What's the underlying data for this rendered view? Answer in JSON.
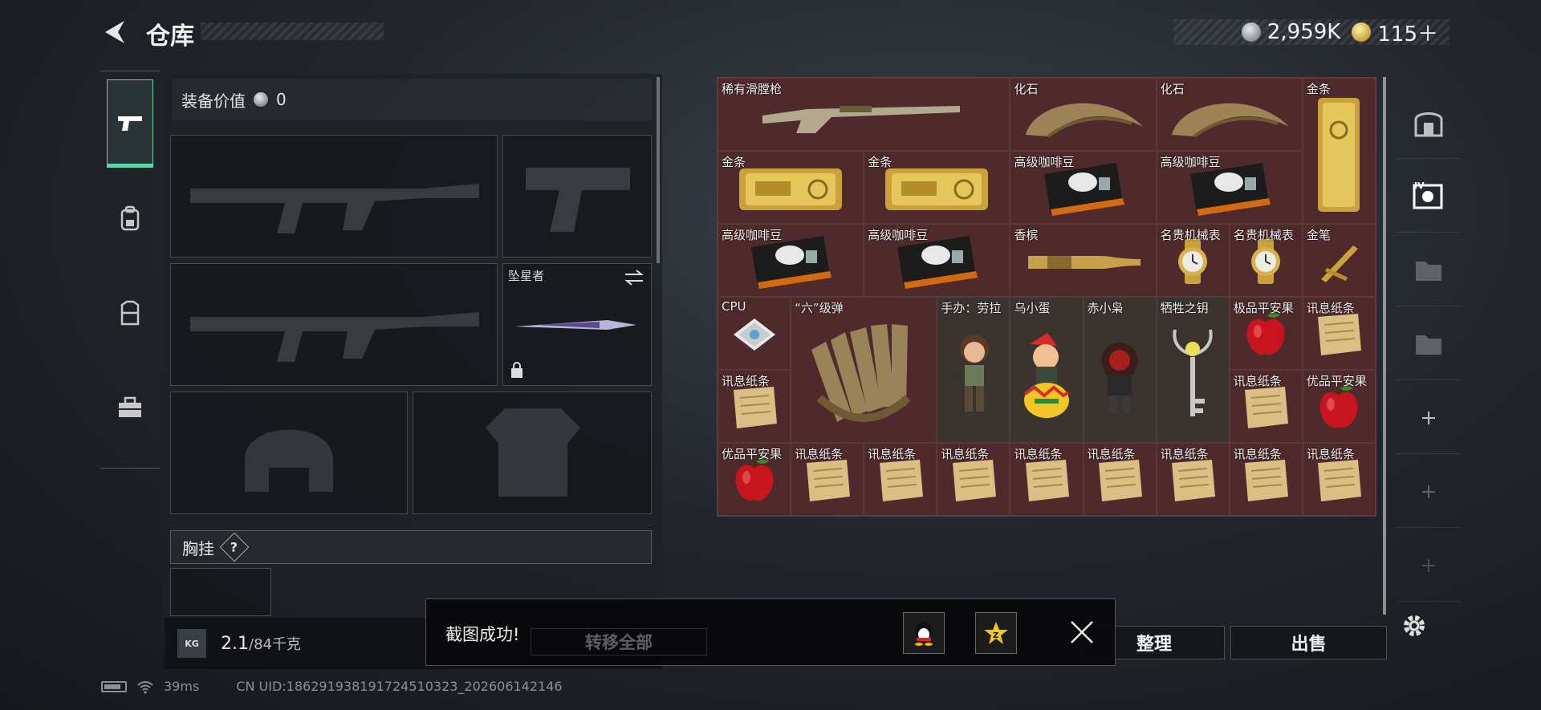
{
  "header": {
    "title": "仓库",
    "currency": [
      {
        "icon": "silver-coin-icon",
        "value": "2,959K"
      },
      {
        "icon": "gold-coin-icon",
        "value": "115＋"
      }
    ]
  },
  "left_tabs": [
    {
      "icon": "pistol-icon",
      "active": true
    },
    {
      "icon": "backpack-icon",
      "active": false
    },
    {
      "icon": "vest-icon",
      "active": false
    },
    {
      "icon": "toolbox-icon",
      "active": false
    }
  ],
  "equipment": {
    "value_label": "装备价值",
    "value_amount": "0",
    "melee_slot_label": "坠星者",
    "chest_label": "胸挂",
    "chest_help": "?",
    "weight_current": "2.1",
    "weight_max": "/84千克",
    "kg_badge": "KG"
  },
  "stash": {
    "items": [
      {
        "label": "稀有滑膛枪",
        "icon": "musket-icon",
        "col": 1,
        "row": 1,
        "w": 4,
        "h": 1
      },
      {
        "label": "化石",
        "icon": "fossil-claw-icon",
        "col": 5,
        "row": 1,
        "w": 2,
        "h": 1
      },
      {
        "label": "化石",
        "icon": "fossil-claw-icon",
        "col": 7,
        "row": 1,
        "w": 2,
        "h": 1
      },
      {
        "label": "金条",
        "icon": "gold-bar-icon",
        "col": 9,
        "row": 1,
        "w": 1,
        "h": 2
      },
      {
        "label": "金条",
        "icon": "gold-bar-icon",
        "col": 1,
        "row": 2,
        "w": 2,
        "h": 1
      },
      {
        "label": "金条",
        "icon": "gold-bar-icon",
        "col": 3,
        "row": 2,
        "w": 2,
        "h": 1
      },
      {
        "label": "高级咖啡豆",
        "icon": "coffee-beans-icon",
        "col": 5,
        "row": 2,
        "w": 2,
        "h": 1
      },
      {
        "label": "高级咖啡豆",
        "icon": "coffee-beans-icon",
        "col": 7,
        "row": 2,
        "w": 2,
        "h": 1
      },
      {
        "label": "高级咖啡豆",
        "icon": "coffee-beans-icon",
        "col": 1,
        "row": 3,
        "w": 2,
        "h": 1
      },
      {
        "label": "高级咖啡豆",
        "icon": "coffee-beans-icon",
        "col": 3,
        "row": 3,
        "w": 2,
        "h": 1
      },
      {
        "label": "香槟",
        "icon": "champagne-icon",
        "col": 5,
        "row": 3,
        "w": 2,
        "h": 1
      },
      {
        "label": "名贵机械表",
        "icon": "watch-icon",
        "col": 7,
        "row": 3,
        "w": 1,
        "h": 1
      },
      {
        "label": "名贵机械表",
        "icon": "watch-icon",
        "col": 8,
        "row": 3,
        "w": 1,
        "h": 1
      },
      {
        "label": "金笔",
        "icon": "gold-pen-icon",
        "col": 9,
        "row": 3,
        "w": 1,
        "h": 1
      },
      {
        "label": "CPU",
        "icon": "cpu-icon",
        "col": 1,
        "row": 4,
        "w": 1,
        "h": 1
      },
      {
        "label": "“六”级弹",
        "icon": "bullets-icon",
        "col": 2,
        "row": 4,
        "w": 2,
        "h": 2
      },
      {
        "label": "手办：劳拉",
        "icon": "figure-lara-icon",
        "col": 4,
        "row": 4,
        "w": 1,
        "h": 2
      },
      {
        "label": "乌小蛋",
        "icon": "figure-egg-icon",
        "col": 5,
        "row": 4,
        "w": 1,
        "h": 2
      },
      {
        "label": "赤小枭",
        "icon": "figure-hood-icon",
        "col": 6,
        "row": 4,
        "w": 1,
        "h": 2
      },
      {
        "label": "牺牲之钥",
        "icon": "key-icon",
        "col": 7,
        "row": 4,
        "w": 1,
        "h": 2
      },
      {
        "label": "极品平安果",
        "icon": "apple-icon",
        "col": 8,
        "row": 4,
        "w": 1,
        "h": 1
      },
      {
        "label": "讯息纸条",
        "icon": "paper-note-icon",
        "col": 9,
        "row": 4,
        "w": 1,
        "h": 1
      },
      {
        "label": "讯息纸条",
        "icon": "paper-note-icon",
        "col": 1,
        "row": 5,
        "w": 1,
        "h": 1
      },
      {
        "label": "讯息纸条",
        "icon": "paper-note-icon",
        "col": 8,
        "row": 5,
        "w": 1,
        "h": 1
      },
      {
        "label": "优品平安果",
        "icon": "apple-icon",
        "col": 9,
        "row": 5,
        "w": 1,
        "h": 1
      },
      {
        "label": "优品平安果",
        "icon": "apple-icon",
        "col": 1,
        "row": 6,
        "w": 1,
        "h": 1
      },
      {
        "label": "讯息纸条",
        "icon": "paper-note-icon",
        "col": 2,
        "row": 6,
        "w": 1,
        "h": 1
      },
      {
        "label": "讯息纸条",
        "icon": "paper-note-icon",
        "col": 3,
        "row": 6,
        "w": 1,
        "h": 1
      },
      {
        "label": "讯息纸条",
        "icon": "paper-note-icon",
        "col": 4,
        "row": 6,
        "w": 1,
        "h": 1
      },
      {
        "label": "讯息纸条",
        "icon": "paper-note-icon",
        "col": 5,
        "row": 6,
        "w": 1,
        "h": 1
      },
      {
        "label": "讯息纸条",
        "icon": "paper-note-icon",
        "col": 6,
        "row": 6,
        "w": 1,
        "h": 1
      },
      {
        "label": "讯息纸条",
        "icon": "paper-note-icon",
        "col": 7,
        "row": 6,
        "w": 1,
        "h": 1
      },
      {
        "label": "讯息纸条",
        "icon": "paper-note-icon",
        "col": 8,
        "row": 6,
        "w": 1,
        "h": 1
      },
      {
        "label": "讯息纸条",
        "icon": "paper-note-icon",
        "col": 9,
        "row": 6,
        "w": 1,
        "h": 1
      }
    ]
  },
  "actions": {
    "transfer_all": "转移全部",
    "sort": "整理",
    "sell": "出售"
  },
  "toast": {
    "message": "截图成功!",
    "qq_icon": "qq-penguin-icon",
    "qzone_icon": "qzone-star-icon"
  },
  "status_bar": {
    "ping": "39ms",
    "uid": "CN UID:18629193819172451032​3_202606142146"
  }
}
